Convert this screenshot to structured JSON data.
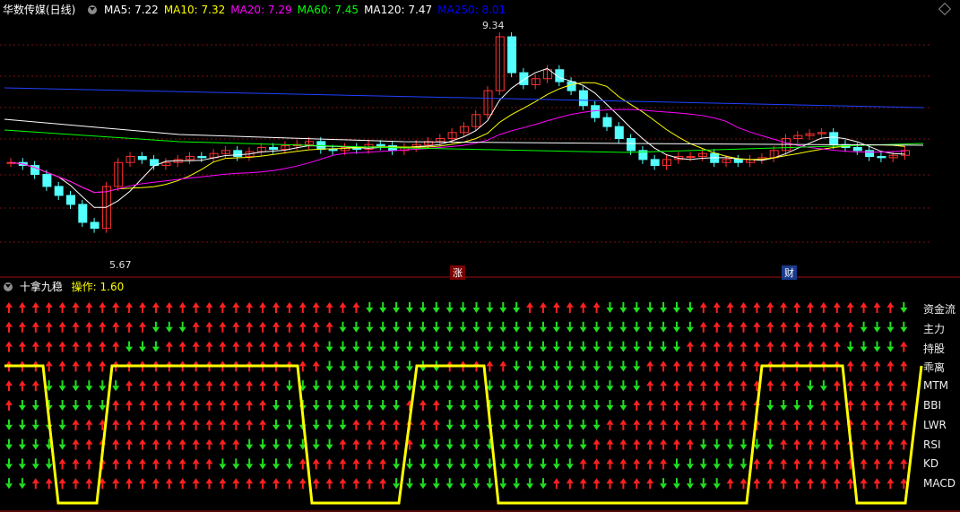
{
  "top_panel": {
    "stock_name": "华数传媒(日线)",
    "ma_labels": [
      {
        "text": "MA5: 7.22",
        "color": "#ffffff"
      },
      {
        "text": "MA10: 7.32",
        "color": "#ffff00"
      },
      {
        "text": "MA20: 7.29",
        "color": "#ff00ff"
      },
      {
        "text": "MA60: 7.45",
        "color": "#00ff00"
      },
      {
        "text": "MA120: 7.47",
        "color": "#ffffff"
      },
      {
        "text": "MA250: 8.01",
        "color": "#0000ff"
      }
    ],
    "high_label": "9.34",
    "low_label": "5.67",
    "event_rise": "涨",
    "event_fin": "财"
  },
  "bottom_panel": {
    "indicator_name": "十拿九稳",
    "op_label": "操作: 1.60",
    "row_labels": [
      "资金流",
      "主力",
      "持股",
      "乖离",
      "MTM",
      "BBI",
      "LWR",
      "RSI",
      "KD",
      "MACD"
    ]
  },
  "colors": {
    "up": "#ff3030",
    "down": "#54ffff",
    "arrow_up": "#ff2020",
    "arrow_down": "#20e020",
    "line": "#ffff00"
  }
}
